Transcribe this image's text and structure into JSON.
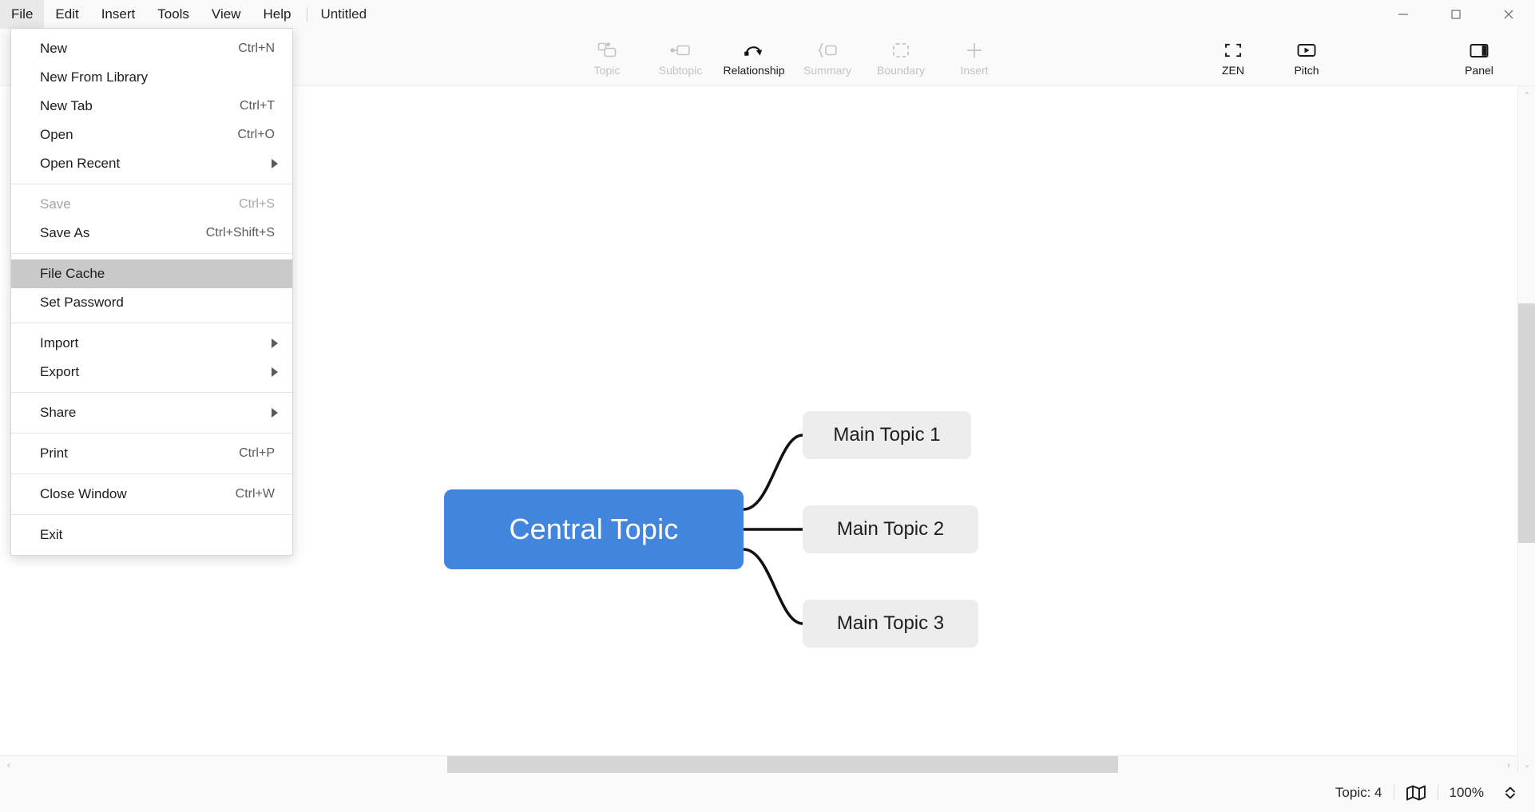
{
  "window": {
    "document_title": "Untitled",
    "controls": {
      "minimize": "minimize-button",
      "maximize": "maximize-button",
      "close": "close-button"
    }
  },
  "menubar": {
    "items": [
      {
        "label": "File",
        "open": true
      },
      {
        "label": "Edit",
        "open": false
      },
      {
        "label": "Insert",
        "open": false
      },
      {
        "label": "Tools",
        "open": false
      },
      {
        "label": "View",
        "open": false
      },
      {
        "label": "Help",
        "open": false
      }
    ]
  },
  "file_menu": {
    "groups": [
      {
        "items": [
          {
            "label": "New",
            "shortcut": "Ctrl+N",
            "submenu": false,
            "disabled": false,
            "highlight": false
          },
          {
            "label": "New From Library",
            "shortcut": "",
            "submenu": false,
            "disabled": false,
            "highlight": false
          },
          {
            "label": "New Tab",
            "shortcut": "Ctrl+T",
            "submenu": false,
            "disabled": false,
            "highlight": false
          },
          {
            "label": "Open",
            "shortcut": "Ctrl+O",
            "submenu": false,
            "disabled": false,
            "highlight": false
          },
          {
            "label": "Open Recent",
            "shortcut": "",
            "submenu": true,
            "disabled": false,
            "highlight": false
          }
        ]
      },
      {
        "items": [
          {
            "label": "Save",
            "shortcut": "Ctrl+S",
            "submenu": false,
            "disabled": true,
            "highlight": false
          },
          {
            "label": "Save As",
            "shortcut": "Ctrl+Shift+S",
            "submenu": false,
            "disabled": false,
            "highlight": false
          }
        ]
      },
      {
        "items": [
          {
            "label": "File Cache",
            "shortcut": "",
            "submenu": false,
            "disabled": false,
            "highlight": true
          },
          {
            "label": "Set Password",
            "shortcut": "",
            "submenu": false,
            "disabled": false,
            "highlight": false
          }
        ]
      },
      {
        "items": [
          {
            "label": "Import",
            "shortcut": "",
            "submenu": true,
            "disabled": false,
            "highlight": false
          },
          {
            "label": "Export",
            "shortcut": "",
            "submenu": true,
            "disabled": false,
            "highlight": false
          }
        ]
      },
      {
        "items": [
          {
            "label": "Share",
            "shortcut": "",
            "submenu": true,
            "disabled": false,
            "highlight": false
          }
        ]
      },
      {
        "items": [
          {
            "label": "Print",
            "shortcut": "Ctrl+P",
            "submenu": false,
            "disabled": false,
            "highlight": false
          }
        ]
      },
      {
        "items": [
          {
            "label": "Close Window",
            "shortcut": "Ctrl+W",
            "submenu": false,
            "disabled": false,
            "highlight": false
          }
        ]
      },
      {
        "items": [
          {
            "label": "Exit",
            "shortcut": "",
            "submenu": false,
            "disabled": false,
            "highlight": false
          }
        ]
      }
    ]
  },
  "toolbar": {
    "center": [
      {
        "label": "Topic",
        "icon": "topic-icon",
        "disabled": true
      },
      {
        "label": "Subtopic",
        "icon": "subtopic-icon",
        "disabled": true
      },
      {
        "label": "Relationship",
        "icon": "relationship-icon",
        "disabled": false
      },
      {
        "label": "Summary",
        "icon": "summary-icon",
        "disabled": true
      },
      {
        "label": "Boundary",
        "icon": "boundary-icon",
        "disabled": true
      },
      {
        "label": "Insert",
        "icon": "plus-icon",
        "disabled": true
      }
    ],
    "right": [
      {
        "label": "ZEN",
        "icon": "zen-icon",
        "disabled": false
      },
      {
        "label": "Pitch",
        "icon": "pitch-icon",
        "disabled": false
      },
      {
        "label": "Panel",
        "icon": "panel-icon",
        "disabled": false
      }
    ]
  },
  "mindmap": {
    "central": {
      "text": "Central Topic",
      "color": "#4285DC",
      "text_color": "#FFFFFF"
    },
    "branches": [
      {
        "text": "Main Topic 1",
        "color": "#EDEDED",
        "text_color": "#1D1D1D"
      },
      {
        "text": "Main Topic 2",
        "color": "#EDEDED",
        "text_color": "#1D1D1D"
      },
      {
        "text": "Main Topic 3",
        "color": "#EDEDED",
        "text_color": "#1D1D1D"
      }
    ]
  },
  "statusbar": {
    "topic_count": "Topic: 4",
    "map_icon": "map-icon",
    "zoom_level": "100%"
  },
  "colors": {
    "accent": "#4285DC",
    "node_fill": "#EDEDED",
    "chrome": "#FAFAFA",
    "menu_highlight": "#C9C9C9"
  }
}
